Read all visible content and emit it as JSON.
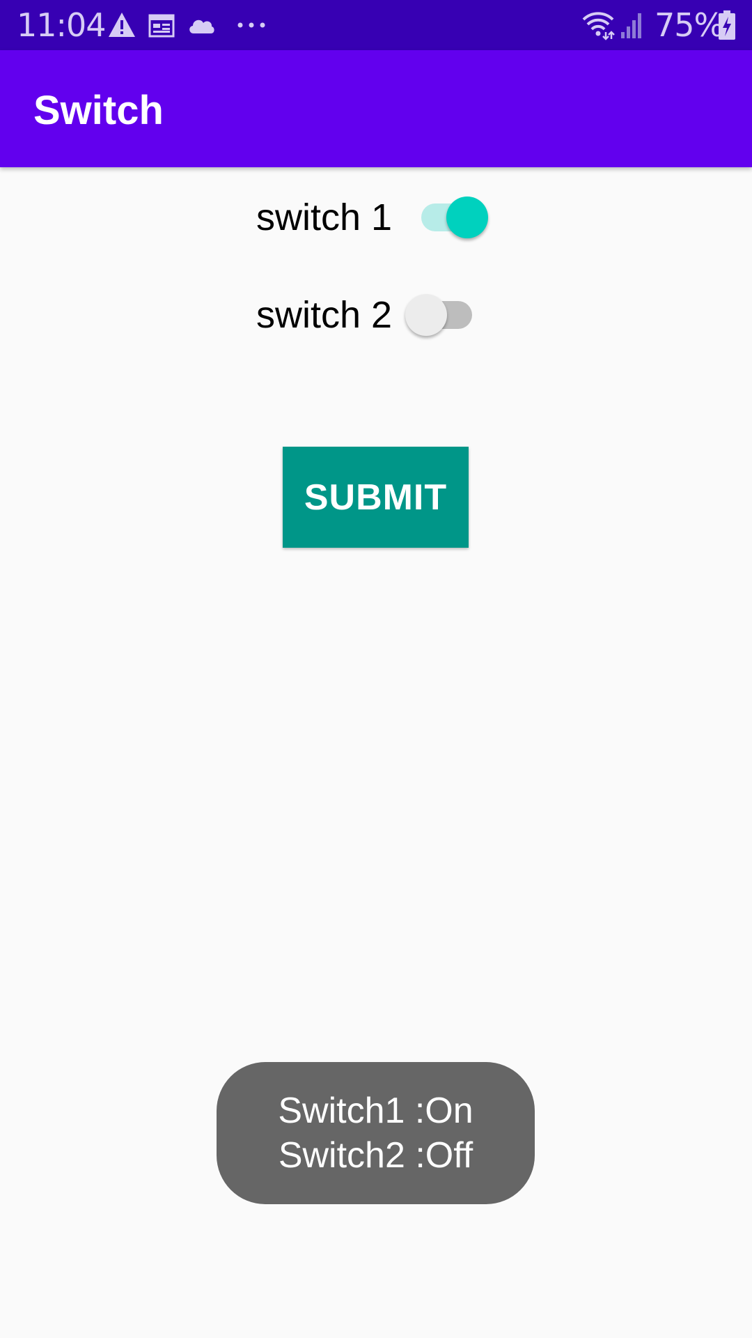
{
  "status_bar": {
    "time": "11:04",
    "battery": "75%",
    "icons": [
      "warning-icon",
      "calendar-icon",
      "cloud-icon",
      "more-notifications-icon",
      "wifi-icon",
      "signal-icon",
      "battery-charging-icon"
    ]
  },
  "app_bar": {
    "title": "Switch",
    "color": "#6200EE"
  },
  "switches": [
    {
      "label": "switch 1",
      "checked": true,
      "thumb_color": "#00D1BE",
      "track_color": "#B7ECE8"
    },
    {
      "label": "switch 2",
      "checked": false,
      "thumb_color": "#ECECEC",
      "track_color": "#BDBDBD"
    }
  ],
  "submit_button": {
    "label": "SUBMIT",
    "color": "#009688"
  },
  "toast": {
    "line1": "Switch1 :On",
    "line2": "Switch2 :Off"
  }
}
